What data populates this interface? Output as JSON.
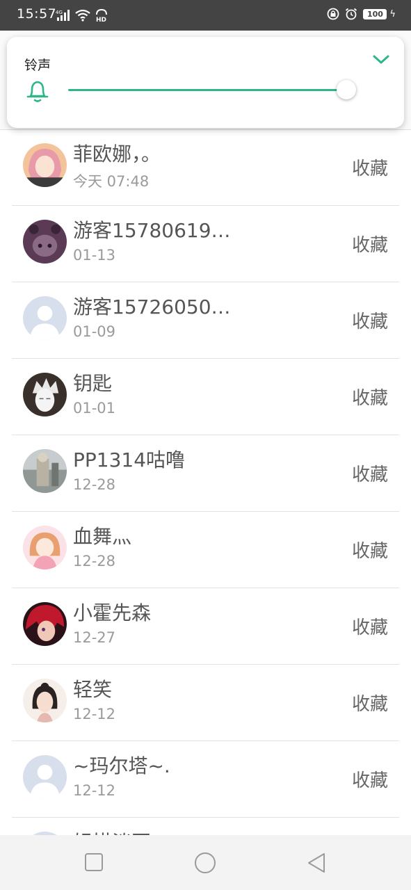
{
  "status_bar": {
    "time": "15:57",
    "signal_label": "4G",
    "hd_label": "HD",
    "battery": "100"
  },
  "volume_panel": {
    "title": "铃声",
    "level": 1.0,
    "accent_color": "#2db787",
    "icons": {
      "ringer": "bell-icon",
      "collapse": "chevron-down-icon"
    }
  },
  "fans_list": {
    "action_label": "收藏",
    "items": [
      {
        "name": "菲欧娜，。",
        "date": "今天 07:48",
        "avatar": "anime-girl-pink"
      },
      {
        "name": "游客15780619…",
        "date": "01-13",
        "avatar": "dark-purple"
      },
      {
        "name": "游客15726050…",
        "date": "01-09",
        "avatar": "default-person"
      },
      {
        "name": "钥匙",
        "date": "01-01",
        "avatar": "sketch-portrait"
      },
      {
        "name": "PP1314咕噜",
        "date": "12-28",
        "avatar": "figure-photo"
      },
      {
        "name": "血舞灬",
        "date": "12-28",
        "avatar": "anime-girl-pink-dress"
      },
      {
        "name": "小霍先森",
        "date": "12-27",
        "avatar": "anime-red-hair"
      },
      {
        "name": "轻笑",
        "date": "12-12",
        "avatar": "girl-portrait"
      },
      {
        "name": "~玛尔塔~.",
        "date": "12-12",
        "avatar": "default-person"
      },
      {
        "name": "轻描淡写",
        "date": "",
        "avatar": "default-person"
      }
    ]
  },
  "nav_bar": {
    "icons": [
      "square-recents-icon",
      "circle-home-icon",
      "triangle-back-icon"
    ]
  }
}
